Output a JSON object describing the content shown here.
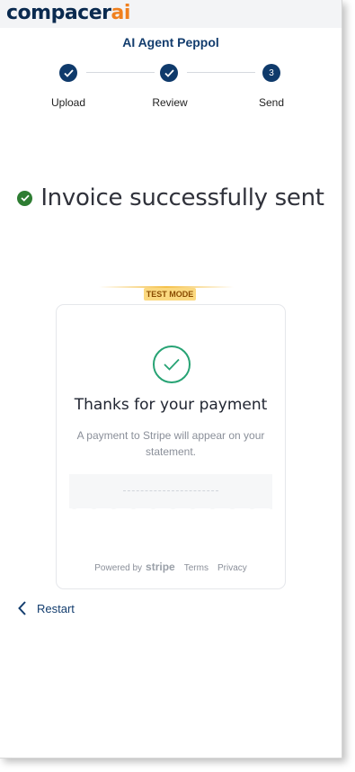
{
  "logo": {
    "part1": "compacer",
    "part2": "ai"
  },
  "title": "AI Agent Peppol",
  "steps": [
    {
      "label": "Upload",
      "state": "done"
    },
    {
      "label": "Review",
      "state": "done"
    },
    {
      "label": "Send",
      "number": "3",
      "state": "current"
    }
  ],
  "success_message": "Invoice successfully sent",
  "test_mode_label": "TEST MODE",
  "payment": {
    "heading": "Thanks for your payment",
    "description": "A payment to Stripe will appear on your statement.",
    "powered_by": "Powered by",
    "brand": "stripe",
    "terms": "Terms",
    "privacy": "Privacy"
  },
  "restart_label": "Restart",
  "colors": {
    "brand_blue": "#0f3a6b",
    "brand_orange": "#f0801e",
    "success_green": "#2e7d32",
    "stripe_green": "#27a374"
  }
}
